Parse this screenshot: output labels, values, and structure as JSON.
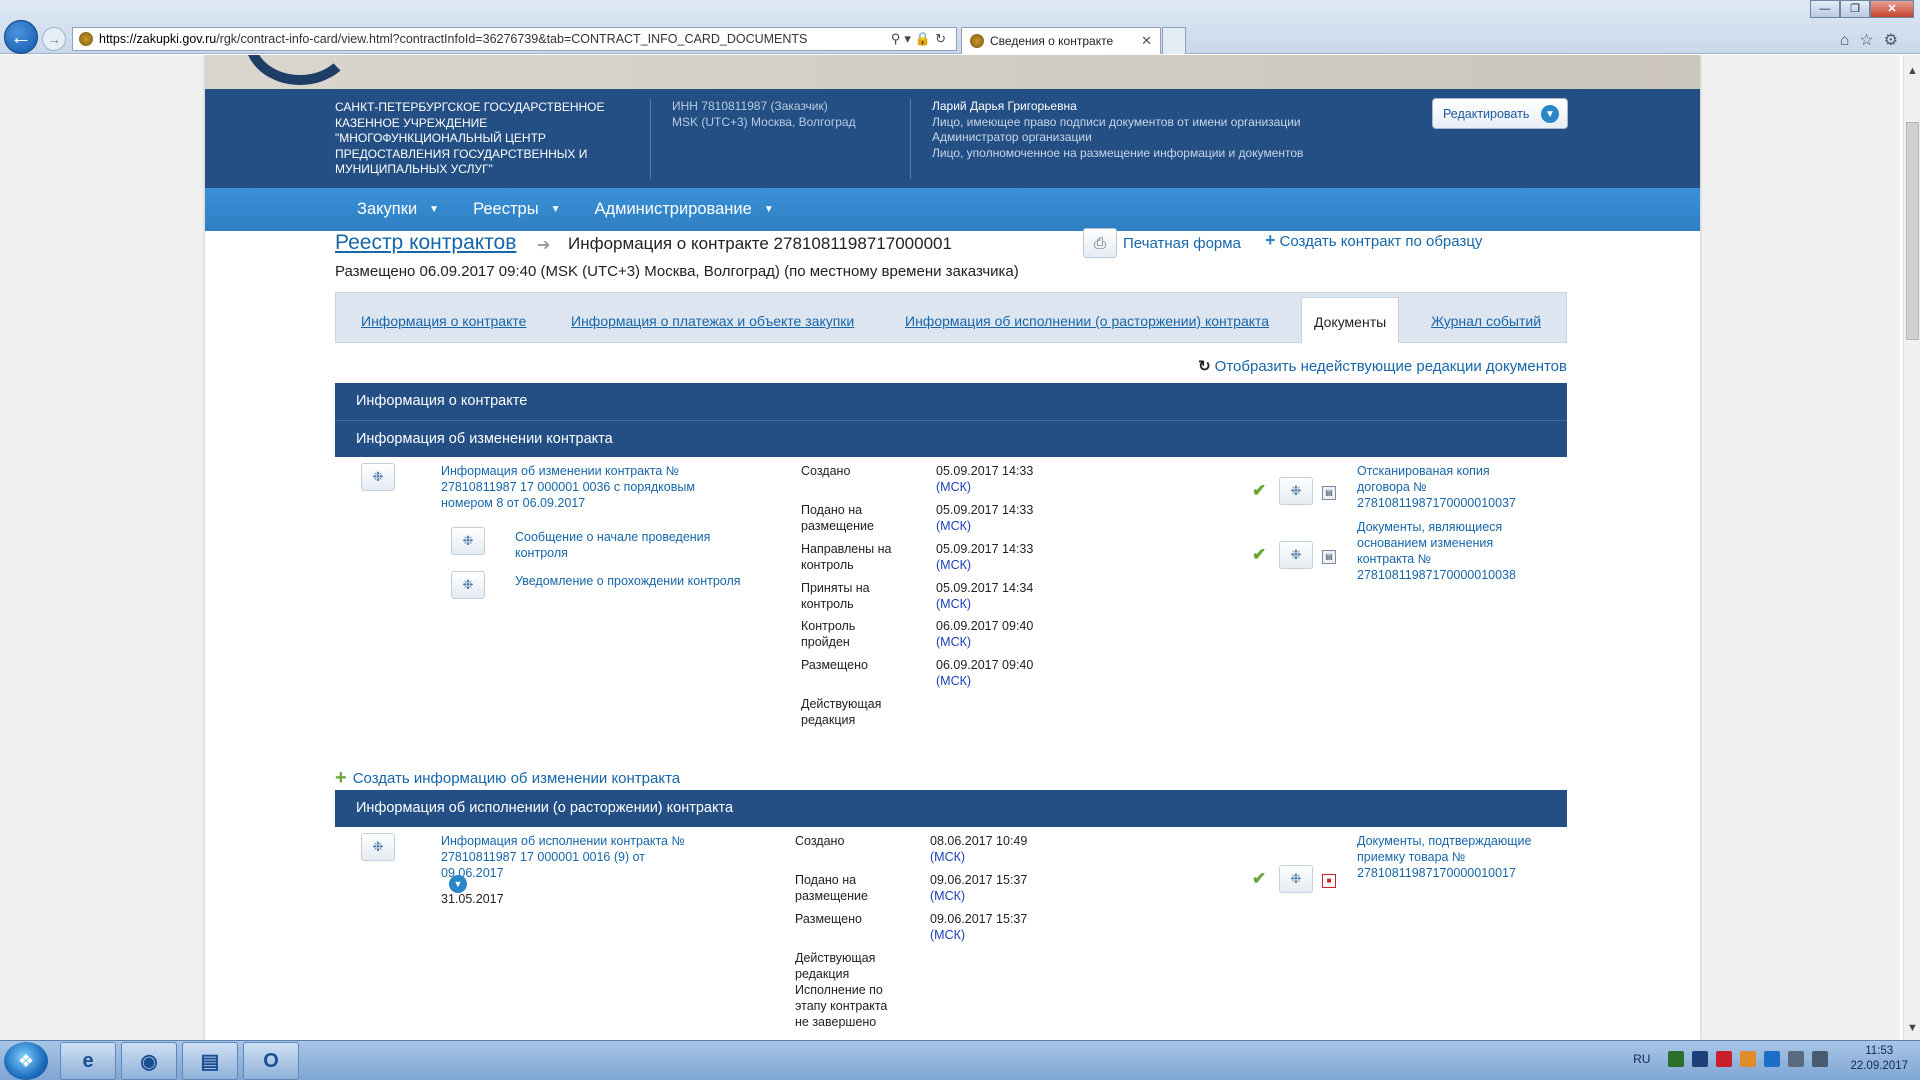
{
  "browser": {
    "url_host": "https://zakupki.gov.ru",
    "url_path": "/rgk/contract-info-card/view.html?contractInfoId=36276739&tab=CONTRACT_INFO_CARD_DOCUMENTS",
    "tab_title": "Сведения о контракте"
  },
  "org": {
    "name": "Санкт-Петербургское государственное казенное учреждение \"Многофункциональный центр предоставления государственных и муниципальных услуг\"",
    "inn": "ИНН 7810811987 (Заказчик)",
    "tz": "MSK (UTC+3) Москва, Волгоград"
  },
  "user": {
    "name": "Ларий Дарья Григорьевна",
    "roles": [
      "Лицо, имеющее право подписи документов от имени организации",
      "Администратор организации",
      "Лицо, уполномоченное на размещение информации и документов"
    ],
    "edit_label": "Редактировать"
  },
  "menu": [
    "Закупки",
    "Реестры",
    "Администрирование"
  ],
  "breadcrumb": {
    "registry": "Реестр контрактов",
    "title": "Информация о контракте 2781081198717000001",
    "print_label": "Печатная форма",
    "create_label": "Создать контракт по образцу",
    "posted": "Размещено 06.09.2017 09:40 (MSK (UTC+3) Москва, Волгоград) (по местному времени заказчика)"
  },
  "tabs": [
    "Информация о контракте",
    "Информация о платежах и объекте закупки",
    "Информация об исполнении (о расторжении) контракта",
    "Документы",
    "Журнал событий"
  ],
  "show_old": "Отобразить недействующие редакции документов",
  "sections": {
    "contract_info": "Информация о контракте",
    "change_info": "Информация об изменении контракта",
    "exec_info": "Информация об исполнении (о расторжении) контракта"
  },
  "change": {
    "doc_title": "Информация об изменении контракта № 27810811987 17 000001 0036 с порядковым номером 8 от 06.09.2017",
    "sub1": "Сообщение о начале проведения контроля",
    "sub2": "Уведомление о прохождении контроля",
    "events": [
      {
        "label": "Создано",
        "date": "05.09.2017 14:33",
        "tz": "(МСК)"
      },
      {
        "label": "Подано на размещение",
        "date": "05.09.2017 14:33",
        "tz": "(МСК)"
      },
      {
        "label": "Направлены на контроль",
        "date": "05.09.2017 14:33",
        "tz": "(МСК)"
      },
      {
        "label": "Приняты на контроль",
        "date": "05.09.2017 14:34",
        "tz": "(МСК)"
      },
      {
        "label": "Контроль пройден",
        "date": "06.09.2017 09:40",
        "tz": "(МСК)"
      },
      {
        "label": "Размещено",
        "date": "06.09.2017 09:40",
        "tz": "(МСК)"
      }
    ],
    "status": "Действующая редакция",
    "files": [
      "Отсканированая копия договора № 27810811987170000010037",
      "Документы, являющиеся основанием изменения контракта № 27810811987170000010038"
    ]
  },
  "add_change": "Создать информацию об изменении контракта",
  "exec": {
    "doc_title": "Информация об исполнении контракта № 27810811987 17 000001 0016 (9) от 09.06.2017",
    "date_below": "31.05.2017",
    "events": [
      {
        "label": "Создано",
        "date": "08.06.2017 10:49",
        "tz": "(МСК)"
      },
      {
        "label": "Подано на размещение",
        "date": "09.06.2017 15:37",
        "tz": "(МСК)"
      },
      {
        "label": "Размещено",
        "date": "09.06.2017 15:37",
        "tz": "(МСК)"
      }
    ],
    "status": "Действующая редакция",
    "status2": "Исполнение по этапу контракта не завершено",
    "file": "Документы, подтверждающие приемку товара № 27810811987170000010017"
  },
  "taskbar": {
    "lang": "RU",
    "time": "11:53",
    "date": "22.09.2017"
  },
  "colors": {
    "header": "#234f84",
    "menu": "#2f7fc4",
    "link": "#1766a9",
    "check": "#6aa53a"
  }
}
